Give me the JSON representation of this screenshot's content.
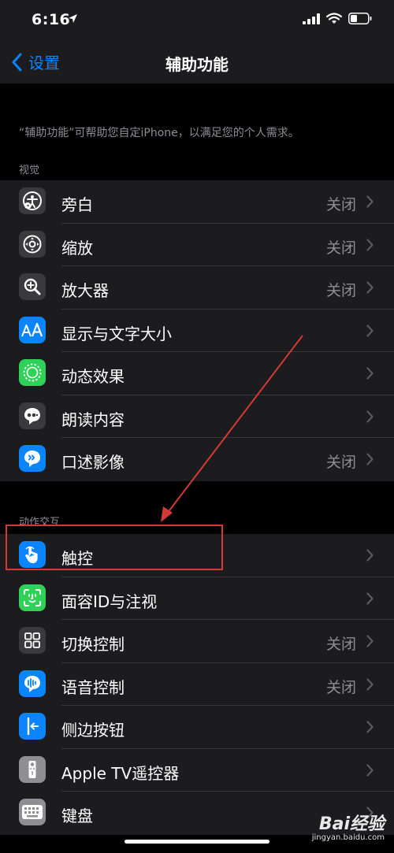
{
  "status": {
    "time": "6:16"
  },
  "nav": {
    "back_label": "设置",
    "title": "辅助功能"
  },
  "intro": "“辅助功能”可帮助您自定iPhone，以满足您的个人需求。",
  "sections": [
    {
      "header": "视觉",
      "items": [
        {
          "label": "旁白",
          "value": "关闭",
          "icon": "voiceover-icon",
          "color": "#3a3a3c"
        },
        {
          "label": "缩放",
          "value": "关闭",
          "icon": "zoom-icon",
          "color": "#3a3a3c"
        },
        {
          "label": "放大器",
          "value": "关闭",
          "icon": "magnifier-icon",
          "color": "#3a3a3c"
        },
        {
          "label": "显示与文字大小",
          "value": "",
          "icon": "text-size-icon",
          "color": "#0a84ff"
        },
        {
          "label": "动态效果",
          "value": "",
          "icon": "motion-icon",
          "color": "#30d158"
        },
        {
          "label": "朗读内容",
          "value": "",
          "icon": "spoken-content-icon",
          "color": "#3a3a3c"
        },
        {
          "label": "口述影像",
          "value": "关闭",
          "icon": "audio-description-icon",
          "color": "#0a84ff"
        }
      ]
    },
    {
      "header": "动作交互",
      "items": [
        {
          "label": "触控",
          "value": "",
          "icon": "touch-icon",
          "color": "#0a84ff"
        },
        {
          "label": "面容ID与注视",
          "value": "",
          "icon": "face-id-icon",
          "color": "#30d158"
        },
        {
          "label": "切换控制",
          "value": "关闭",
          "icon": "switch-control-icon",
          "color": "#3a3a3c"
        },
        {
          "label": "语音控制",
          "value": "关闭",
          "icon": "voice-control-icon",
          "color": "#0a84ff"
        },
        {
          "label": "侧边按钮",
          "value": "",
          "icon": "side-button-icon",
          "color": "#0a84ff"
        },
        {
          "label": "Apple TV遥控器",
          "value": "",
          "icon": "apple-tv-remote-icon",
          "color": "#8e8e93"
        },
        {
          "label": "键盘",
          "value": "",
          "icon": "keyboard-icon",
          "color": "#8e8e93"
        }
      ]
    }
  ],
  "watermark": {
    "main": "Bai经验",
    "sub": "jingyan.baidu.com"
  },
  "colors": {
    "accent": "#0a84ff",
    "annotation": "#d43a35",
    "cell_bg": "#1c1c1e",
    "separator": "#38383a"
  }
}
